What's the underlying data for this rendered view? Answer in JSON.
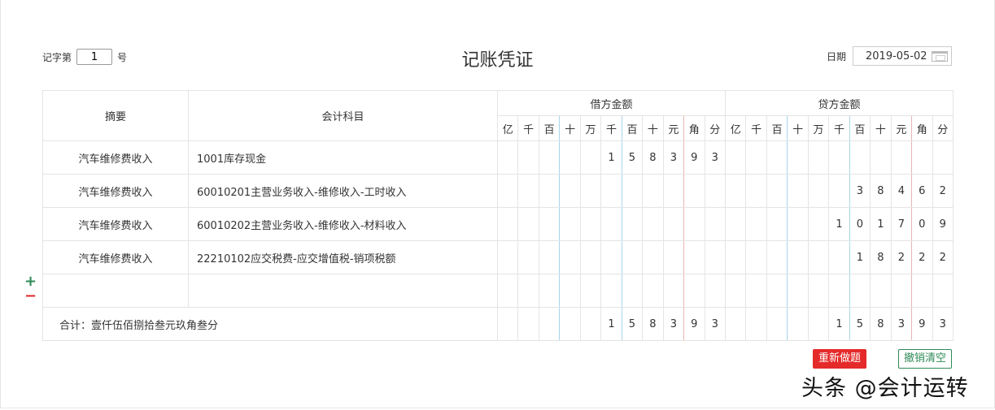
{
  "header": {
    "voucher_prefix": "记字第",
    "voucher_no": "1",
    "voucher_suffix": "号",
    "title": "记账凭证",
    "date_label": "日期",
    "date": "2019-05-02"
  },
  "table": {
    "col_summary": "摘要",
    "col_account": "会计科目",
    "col_debit": "借方金额",
    "col_credit": "贷方金额",
    "units": [
      "亿",
      "千",
      "百",
      "十",
      "万",
      "千",
      "百",
      "十",
      "元",
      "角",
      "分"
    ],
    "rows": [
      {
        "summary": "汽车维修费收入",
        "account": "1001库存现金",
        "debit": "158393",
        "credit": ""
      },
      {
        "summary": "汽车维修费收入",
        "account": "60010201主营业务收入-维修收入-工时收入",
        "debit": "",
        "credit": "38462"
      },
      {
        "summary": "汽车维修费收入",
        "account": "60010202主营业务收入-维修收入-材料收入",
        "debit": "",
        "credit": "101709"
      },
      {
        "summary": "汽车维修费收入",
        "account": "22210102应交税费-应交增值税-销项税额",
        "debit": "",
        "credit": "18222"
      },
      {
        "summary": "",
        "account": "",
        "debit": "",
        "credit": ""
      }
    ],
    "total": {
      "label": "合计：壹仟伍佰捌拾叁元玖角叁分",
      "debit": "158393",
      "credit": "158393"
    }
  },
  "controls": {
    "add": "+",
    "remove": "−",
    "redo": "重新做题",
    "clear": "撤销清空"
  },
  "watermark": "头条 @会计运转"
}
